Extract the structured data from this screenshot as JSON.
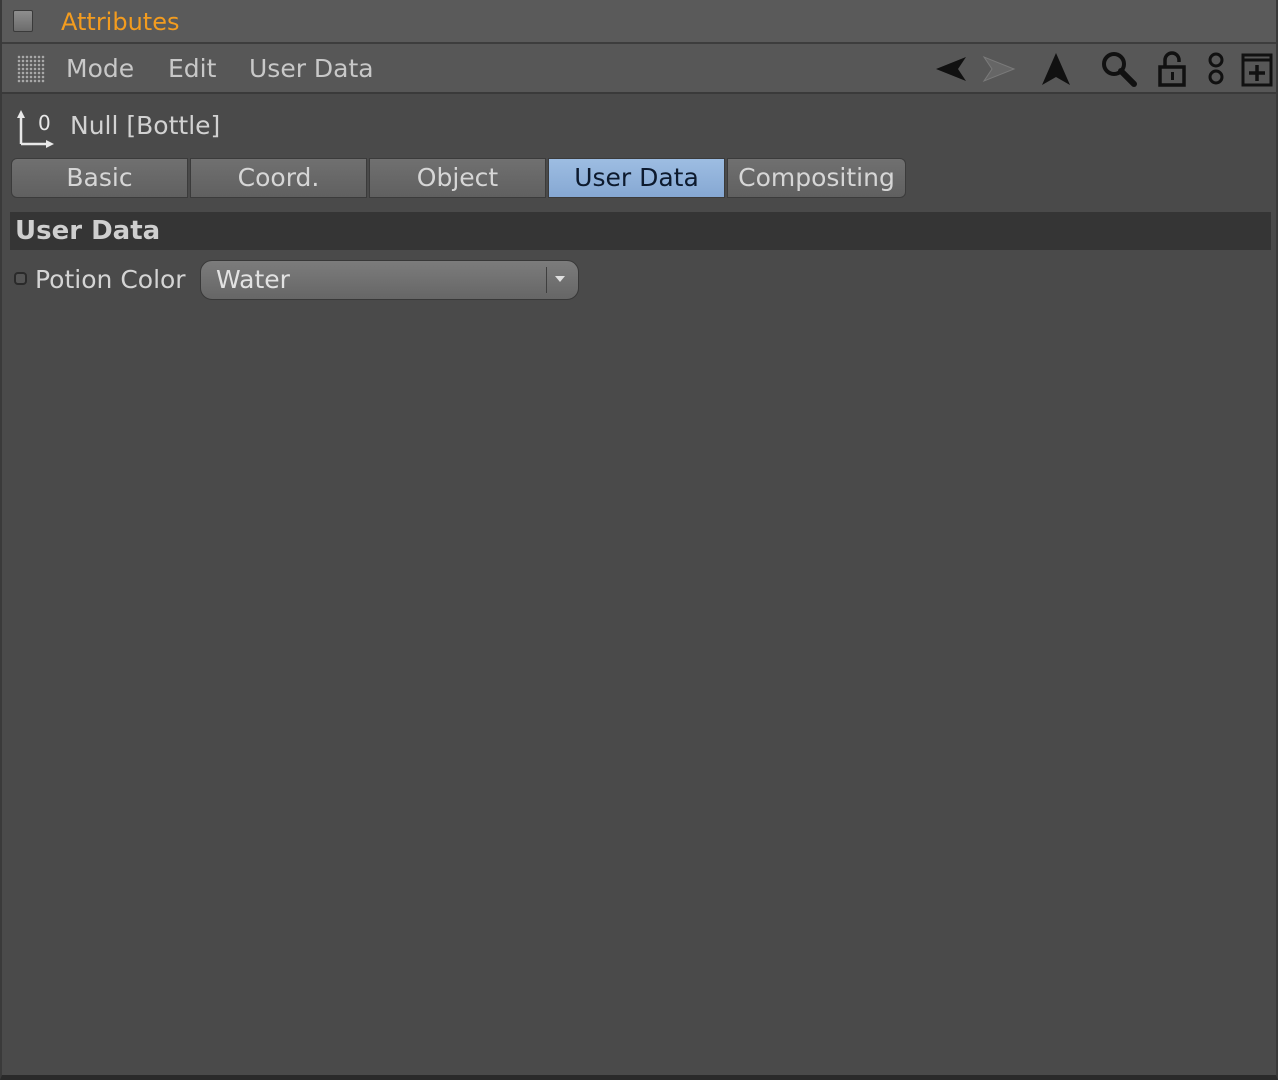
{
  "window": {
    "title": "Attributes"
  },
  "menu": {
    "items": [
      "Mode",
      "Edit",
      "User Data"
    ]
  },
  "toolbar": {
    "icons": [
      "back-arrow-icon",
      "forward-arrow-icon",
      "up-arrow-icon",
      "search-icon",
      "lock-icon",
      "link-icon",
      "new-panel-icon"
    ]
  },
  "object": {
    "name": "Null [Bottle]"
  },
  "tabs": [
    {
      "label": "Basic",
      "active": false
    },
    {
      "label": "Coord.",
      "active": false
    },
    {
      "label": "Object",
      "active": false
    },
    {
      "label": "User Data",
      "active": true
    },
    {
      "label": "Compositing",
      "active": false
    }
  ],
  "section": {
    "title": "User Data"
  },
  "params": [
    {
      "label": "Potion Color",
      "value": "Water"
    }
  ],
  "colors": {
    "title_accent": "#f39c1f",
    "active_tab": "#9dbde2",
    "panel_bg": "#4a4a4a"
  }
}
